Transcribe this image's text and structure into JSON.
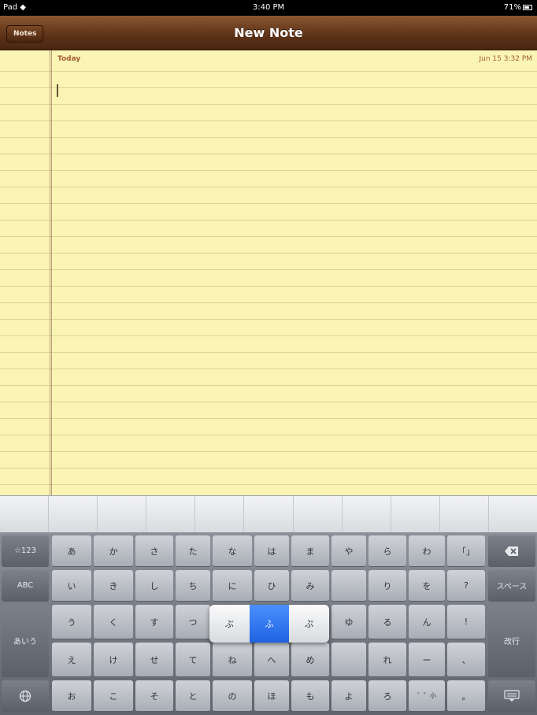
{
  "status": {
    "left": "Pad",
    "time": "3:40 PM",
    "battery": "71%"
  },
  "nav": {
    "back_label": "Notes",
    "title": "New Note"
  },
  "note": {
    "heading": "Today",
    "timestamp": "Jun 15  3:32 PM",
    "body": ""
  },
  "keyboard": {
    "left_keys": [
      "☆123",
      "ABC",
      "あいう"
    ],
    "rows": [
      [
        "あ",
        "か",
        "さ",
        "た",
        "な",
        "は",
        "ま",
        "や",
        "ら",
        "わ",
        "「」"
      ],
      [
        "い",
        "き",
        "し",
        "ち",
        "に",
        "ひ",
        "み",
        "",
        "り",
        "を",
        "?"
      ],
      [
        "う",
        "く",
        "す",
        "つ",
        "",
        "",
        "",
        "ゆ",
        "る",
        "ん",
        "!"
      ],
      [
        "え",
        "け",
        "せ",
        "て",
        "ね",
        "へ",
        "め",
        "",
        "れ",
        "ー",
        "、"
      ],
      [
        "お",
        "こ",
        "そ",
        "と",
        "の",
        "ほ",
        "も",
        "よ",
        "ろ",
        "゛゜小",
        "。"
      ]
    ],
    "popup": [
      "ぶ",
      "ふ",
      "ぷ"
    ],
    "popup_selected": 1,
    "right_keys": {
      "space": "スペース",
      "enter": "改行"
    },
    "icons": [
      "delete-icon",
      "globe-icon",
      "hide-keyboard-icon",
      "wifi-icon",
      "battery-icon"
    ]
  }
}
